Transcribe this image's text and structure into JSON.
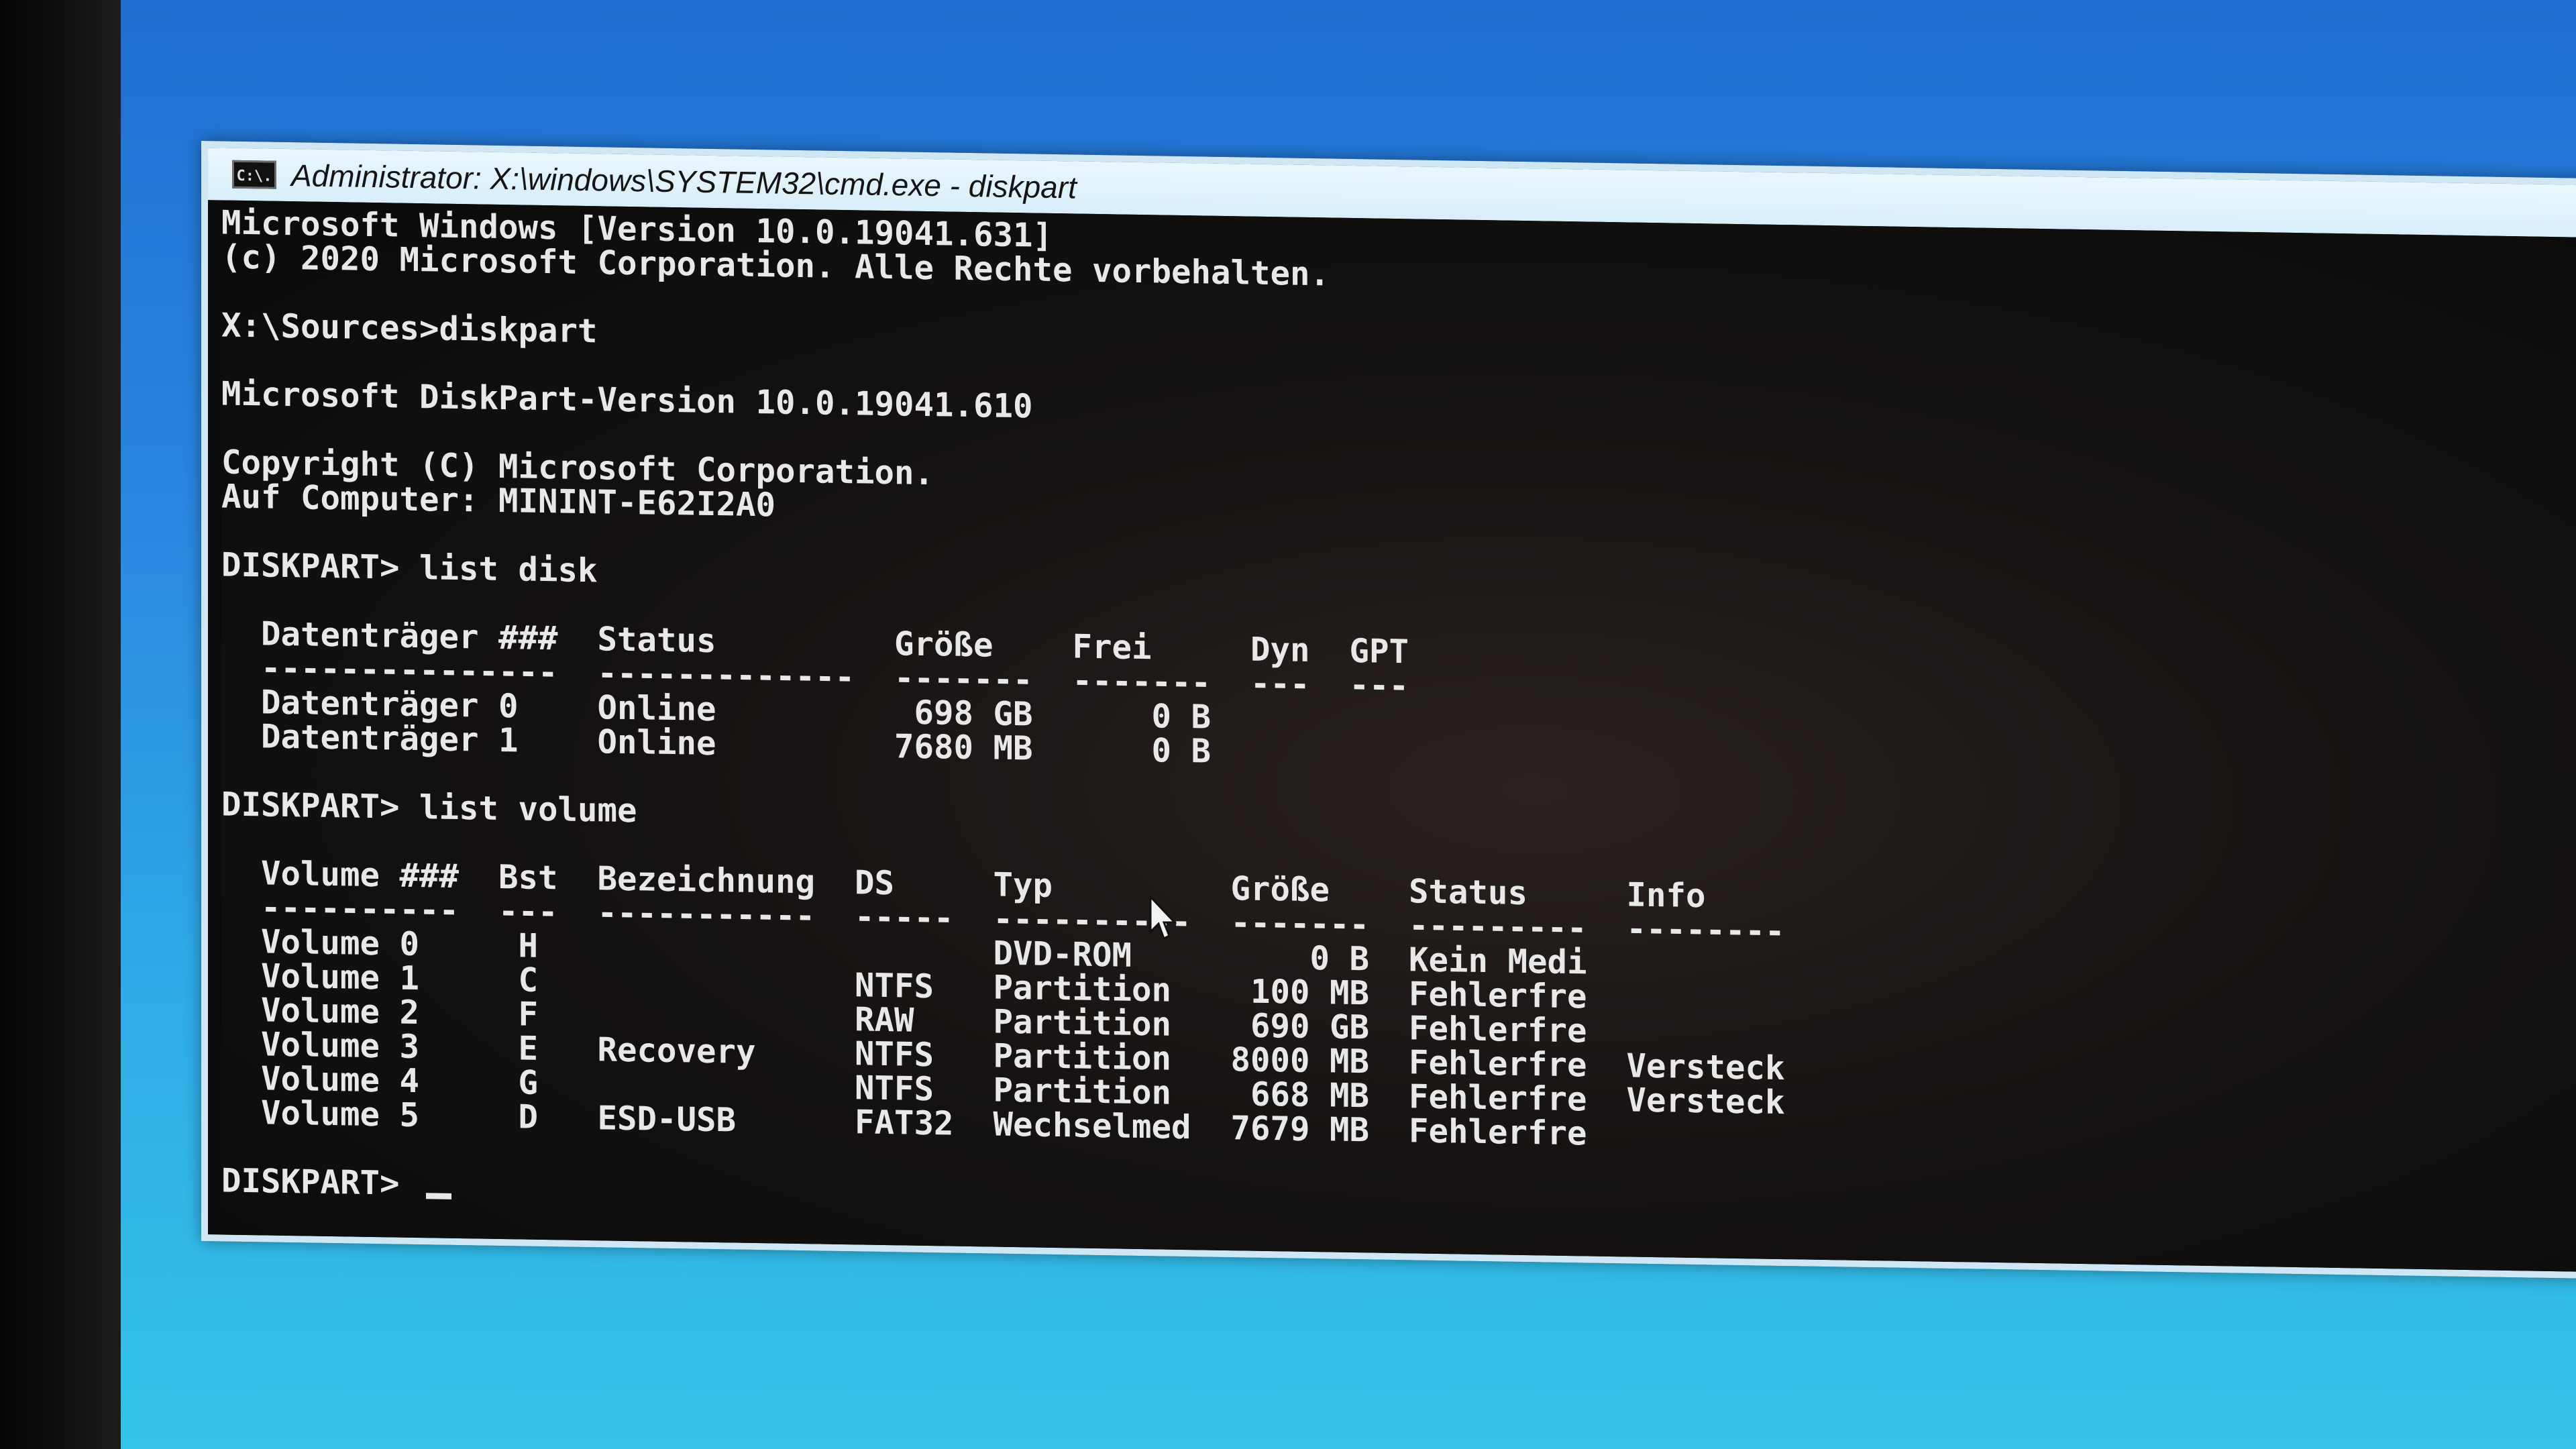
{
  "window": {
    "title": "Administrator: X:\\windows\\SYSTEM32\\cmd.exe - diskpart",
    "icon_text": "C:\\."
  },
  "console": {
    "lines": [
      "Microsoft Windows [Version 10.0.19041.631]",
      "(c) 2020 Microsoft Corporation. Alle Rechte vorbehalten.",
      "",
      "X:\\Sources>diskpart",
      "",
      "Microsoft DiskPart-Version 10.0.19041.610",
      "",
      "Copyright (C) Microsoft Corporation.",
      "Auf Computer: MININT-E62I2A0",
      "",
      "DISKPART> list disk",
      "",
      "  Datenträger ###  Status         Größe    Frei     Dyn  GPT",
      "  ---------------  -------------  -------  -------  ---  ---",
      "  Datenträger 0    Online          698 GB      0 B",
      "  Datenträger 1    Online         7680 MB      0 B",
      "",
      "DISKPART> list volume",
      "",
      "  Volume ###  Bst  Bezeichnung  DS     Typ         Größe    Status     Info",
      "  ----------  ---  -----------  -----  ----------  -------  ---------  --------",
      "  Volume 0     H                       DVD-ROM         0 B  Kein Medi",
      "  Volume 1     C                NTFS   Partition    100 MB  Fehlerfre",
      "  Volume 2     F                RAW    Partition    690 GB  Fehlerfre",
      "  Volume 3     E   Recovery     NTFS   Partition   8000 MB  Fehlerfre  Versteck",
      "  Volume 4     G                NTFS   Partition    668 MB  Fehlerfre  Versteck",
      "  Volume 5     D   ESD-USB      FAT32  Wechselmed  7679 MB  Fehlerfre",
      ""
    ],
    "prompt": "DISKPART> "
  }
}
